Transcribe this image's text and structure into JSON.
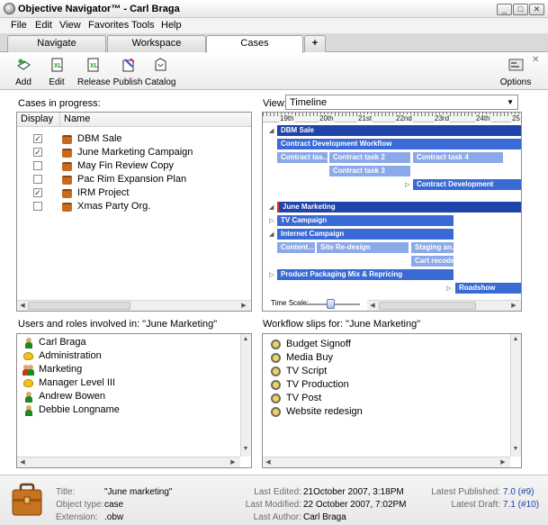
{
  "window": {
    "title": "Objective Navigator™ - Carl Braga"
  },
  "menu": [
    "File",
    "Edit",
    "View",
    "Favorites",
    "Tools",
    "Help"
  ],
  "tabs": [
    {
      "label": "Navigate"
    },
    {
      "label": "Workspace"
    },
    {
      "label": "Cases"
    },
    {
      "label": "+"
    }
  ],
  "toolbar": {
    "add": "Add",
    "edit": "Edit",
    "release": "Release",
    "publish": "Publish",
    "catalog": "Catalog",
    "options": "Options"
  },
  "cases": {
    "title": "Cases in progress:",
    "col_display": "Display",
    "col_name": "Name",
    "items": [
      {
        "name": "DBM Sale",
        "checked": true
      },
      {
        "name": "June Marketing Campaign",
        "checked": true
      },
      {
        "name": "May Fin Review Copy",
        "checked": false
      },
      {
        "name": "Pac Rim Expansion Plan",
        "checked": false
      },
      {
        "name": "IRM Project",
        "checked": true
      },
      {
        "name": "Xmas Party Org.",
        "checked": false
      }
    ]
  },
  "timeline": {
    "view_label": "View:",
    "view_value": "Timeline",
    "dates": [
      "19th",
      "20th",
      "21st",
      "22nd",
      "23rd",
      "24th",
      "25"
    ],
    "time_scale_label": "Time Scale:",
    "bars": {
      "dbm": "DBM Sale",
      "cdw": "Contract Development Workflow",
      "ct1": "Contract tas...",
      "ct2": "Contract task 2",
      "ct3": "Contract task 3",
      "ct4": "Contract task 4",
      "cd": "Contract Development",
      "jm": "June Marketing",
      "tvc": "TV Campaign",
      "ic": "Internet Campaign",
      "cont": "Content...",
      "site": "Site Re-design",
      "stag": "Staging an...",
      "cart": "Cart recode",
      "ppm": "Product Packaging Mix & Repricing",
      "road": "Roadshow"
    }
  },
  "users": {
    "title": "Users and roles involved in: \"June Marketing\"",
    "items": [
      {
        "name": "Carl Braga",
        "type": "user"
      },
      {
        "name": "Administration",
        "type": "role"
      },
      {
        "name": "Marketing",
        "type": "group"
      },
      {
        "name": "Manager Level III",
        "type": "role"
      },
      {
        "name": "Andrew Bowen",
        "type": "user"
      },
      {
        "name": "Debbie Longname",
        "type": "user"
      }
    ]
  },
  "workflow": {
    "title": "Workflow slips for: \"June Marketing\"",
    "items": [
      "Budget Signoff",
      "Media Buy",
      "TV Script",
      "TV Production",
      "TV Post",
      "Website redesign"
    ]
  },
  "status": {
    "title_label": "Title:",
    "title_value": "\"June marketing\"",
    "type_label": "Object type:",
    "type_value": "case",
    "ext_label": "Extension:",
    "ext_value": ".obw",
    "edited_label": "Last Edited:",
    "edited_value": "21October 2007, 3:18PM",
    "modified_label": "Last Modified:",
    "modified_value": "22 October 2007, 7:02PM",
    "author_label": "Last Author:",
    "author_value": "Carl Braga",
    "published_label": "Latest Published:",
    "published_value": "7.0 (#9)",
    "draft_label": "Latest Draft:",
    "draft_value": "7.1 (#10)"
  }
}
